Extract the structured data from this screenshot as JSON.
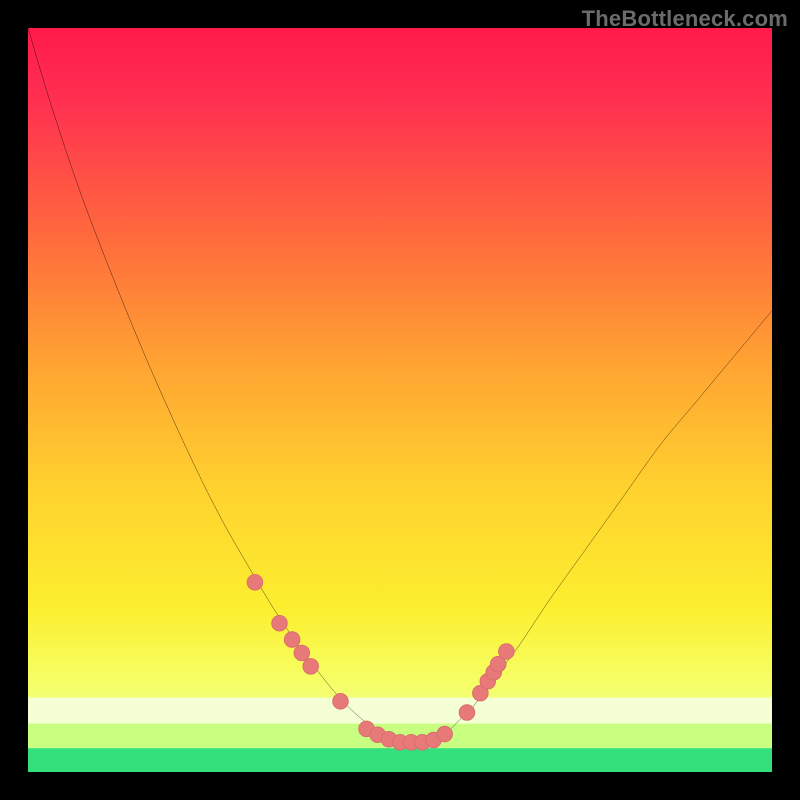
{
  "watermark": "TheBottleneck.com",
  "colors": {
    "frame": "#000000",
    "curve": "#000000",
    "marker_fill": "#e77a79",
    "marker_stroke": "#d96c6b",
    "bottom_band": "#33e07c",
    "glow_band_1": "#c8ff80",
    "glow_band_2": "#f5ffd6"
  },
  "chart_data": {
    "type": "line",
    "title": "",
    "xlabel": "",
    "ylabel": "",
    "xlim": [
      0,
      100
    ],
    "ylim": [
      0,
      100
    ],
    "curve": {
      "x": [
        0,
        3,
        7,
        12,
        17,
        22,
        26,
        30,
        33,
        36,
        39,
        41,
        43,
        45,
        47,
        50,
        53,
        55,
        56.5,
        58,
        60,
        63,
        66,
        70,
        75,
        80,
        85,
        90,
        95,
        100
      ],
      "y": [
        100,
        90,
        78,
        65,
        53,
        42,
        34,
        27,
        22,
        17.5,
        13.5,
        11,
        8.8,
        7,
        5.5,
        4,
        4,
        4.6,
        5.5,
        7,
        9,
        13,
        17,
        23,
        30,
        37,
        44,
        50,
        56,
        62
      ]
    },
    "markers": {
      "x": [
        30.5,
        33.8,
        35.5,
        36.8,
        38,
        42,
        45.5,
        47,
        48.5,
        50,
        51.5,
        53,
        54.5,
        56,
        59,
        60.8,
        61.8,
        62.6,
        63.2,
        64.3
      ],
      "y": [
        25.5,
        20,
        17.8,
        16,
        14.2,
        9.5,
        5.8,
        5,
        4.4,
        4,
        4,
        4,
        4.3,
        5.1,
        8,
        10.6,
        12.2,
        13.4,
        14.5,
        16.2
      ]
    }
  }
}
